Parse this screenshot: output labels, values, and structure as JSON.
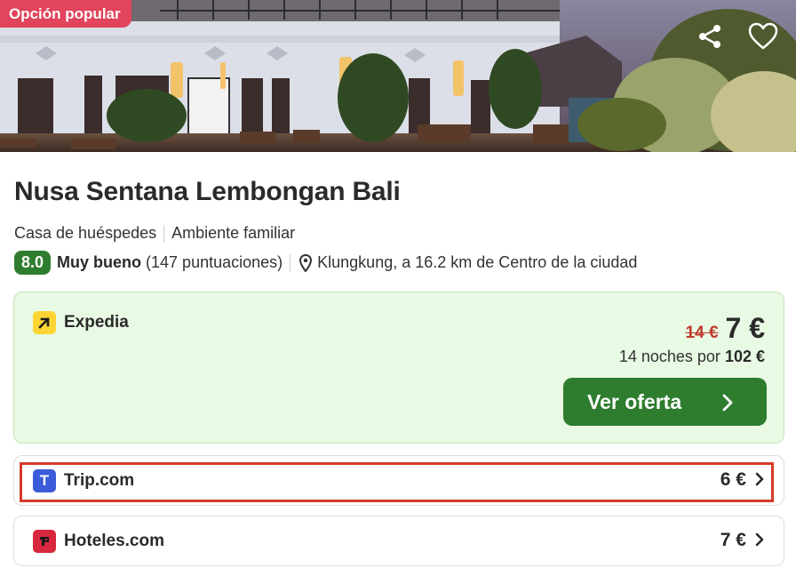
{
  "hero": {
    "badge": "Opción popular",
    "share_icon": "share-icon",
    "favorite_icon": "heart-icon"
  },
  "hotel": {
    "name": "Nusa Sentana Lembongan Bali",
    "type": "Casa de huéspedes",
    "feature": "Ambiente familiar",
    "score": "8.0",
    "rating_label": "Muy bueno",
    "reviews": "(147 puntuaciones)",
    "location": "Klungkung, a 16.2 km de Centro de la ciudad"
  },
  "deal": {
    "provider": "Expedia",
    "old_price": "14 €",
    "price": "7 €",
    "nights_text": "14 noches por",
    "total": "102 €",
    "cta": "Ver oferta"
  },
  "offers": [
    {
      "provider": "Trip.com",
      "price": "6 €",
      "logo_letter": "T",
      "logo_color": "#3a5bd9"
    },
    {
      "provider": "Hoteles.com",
      "price": "7 €",
      "logo_color": "#d8283d"
    }
  ],
  "colors": {
    "accent_green": "#2e7d2f",
    "deal_bg": "#e8f9e4",
    "badge_red": "#e1445b",
    "highlight_red": "#d63a2a",
    "expedia_yellow": "#fcd535"
  }
}
